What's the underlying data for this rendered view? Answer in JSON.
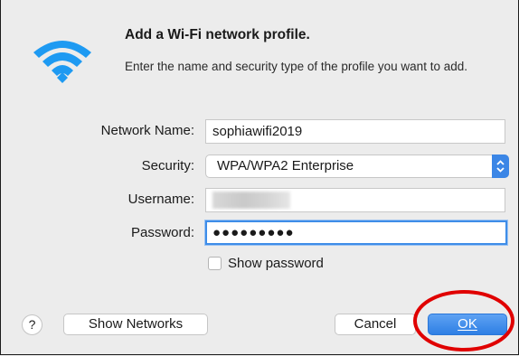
{
  "dialog": {
    "title": "Add a Wi-Fi network profile.",
    "subtitle": "Enter the name and security type of the profile you want to add."
  },
  "icon": "wifi-icon",
  "form": {
    "network_name_label": "Network Name:",
    "network_name_value": "sophiawifi2019",
    "security_label": "Security:",
    "security_value": "WPA/WPA2 Enterprise",
    "username_label": "Username:",
    "username_value": "",
    "password_label": "Password:",
    "password_value": "●●●●●●●●●",
    "show_password_label": "Show password",
    "show_password_checked": false
  },
  "buttons": {
    "help": "?",
    "show_networks": "Show Networks",
    "cancel": "Cancel",
    "ok": "OK"
  },
  "colors": {
    "accent": "#3b86e6",
    "annotation": "#e00000",
    "background": "#ececec"
  }
}
